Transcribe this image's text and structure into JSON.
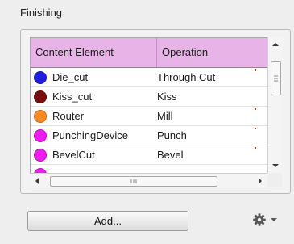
{
  "panel": {
    "title": "Finishing"
  },
  "table": {
    "headers": [
      "Content Element",
      "Operation"
    ],
    "rows": [
      {
        "name": "Die_cut",
        "operation": "Through Cut",
        "color": "#1f1fe0"
      },
      {
        "name": "Kiss_cut",
        "operation": "Kiss",
        "color": "#7a0d0d"
      },
      {
        "name": "Router",
        "operation": "Mill",
        "color": "#ff8a1f"
      },
      {
        "name": "PunchingDevice",
        "operation": "Punch",
        "color": "#f01bf0"
      },
      {
        "name": "BevelCut",
        "operation": "Bevel",
        "color": "#f01bf0"
      }
    ]
  },
  "buttons": {
    "add_label": "Add..."
  },
  "icons": {
    "settings": "gear-icon",
    "settings_menu": "caret-down-icon"
  }
}
